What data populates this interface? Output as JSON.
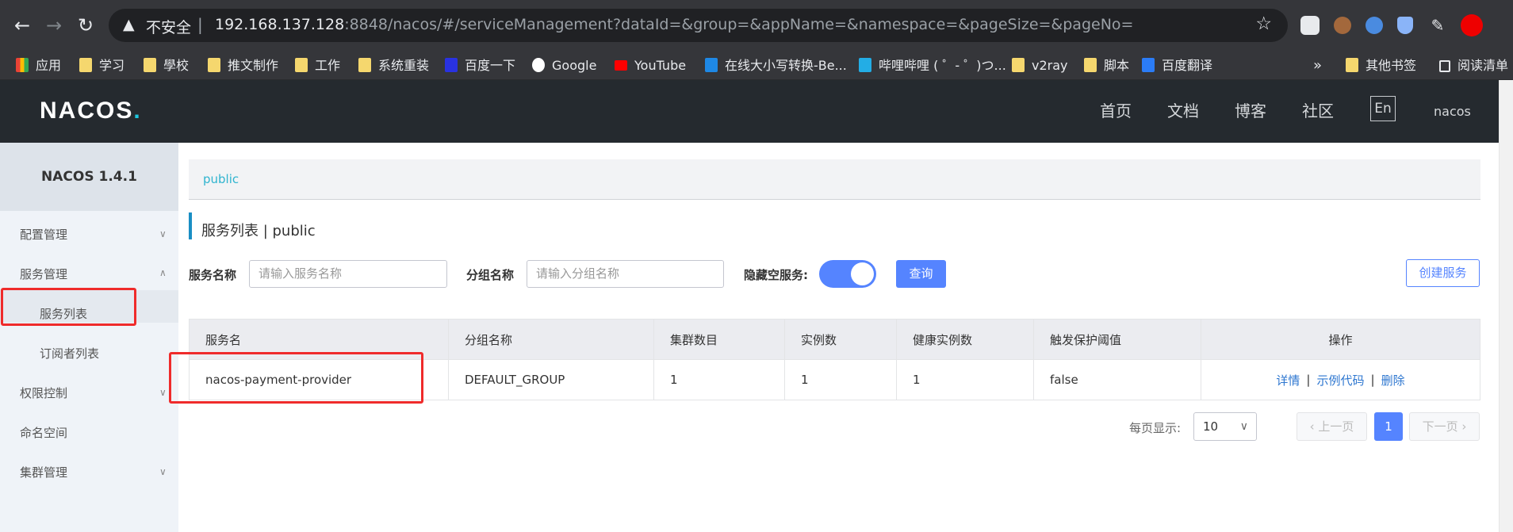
{
  "browser": {
    "insecure_label": "不安全",
    "url_host": "192.168.137.128",
    "url_rest": ":8848/nacos/#/serviceManagement?dataId=&group=&appName=&namespace=&pageSize=&pageNo=",
    "bookmarks": [
      "应用",
      "学习",
      "學校",
      "推文制作",
      "工作",
      "系统重装",
      "百度一下",
      "Google",
      "YouTube",
      "在线大小写转换-Be...",
      "哔哩哔哩 ( ゜- ゜)つ...",
      "v2ray",
      "脚本",
      "百度翻译"
    ],
    "overflow": "»",
    "other_bookmarks": "其他书签",
    "reading_list": "阅读清单"
  },
  "header": {
    "logo": "NACOS",
    "logo_dot": ".",
    "nav": [
      "首页",
      "文档",
      "博客",
      "社区"
    ],
    "lang": "En",
    "user": "nacos"
  },
  "sidebar": {
    "title": "NACOS 1.4.1",
    "items": [
      "配置管理",
      "服务管理",
      "服务列表",
      "订阅者列表",
      "权限控制",
      "命名空间",
      "集群管理"
    ]
  },
  "main": {
    "namespace_tag": "public",
    "page_title": "服务列表  |  public",
    "filters": {
      "service_label": "服务名称",
      "service_placeholder": "请输入服务名称",
      "group_label": "分组名称",
      "group_placeholder": "请输入分组名称",
      "hide_empty_label": "隐藏空服务:",
      "query_button": "查询",
      "create_button": "创建服务"
    },
    "table": {
      "headers": [
        "服务名",
        "分组名称",
        "集群数目",
        "实例数",
        "健康实例数",
        "触发保护阈值",
        "操作"
      ],
      "rows": [
        {
          "name": "nacos-payment-provider",
          "group": "DEFAULT_GROUP",
          "clusters": "1",
          "instances": "1",
          "healthy": "1",
          "threshold": "false"
        }
      ],
      "actions": [
        "详情",
        "示例代码",
        "删除"
      ]
    },
    "pagination": {
      "per_page_label": "每页显示:",
      "per_page": "10",
      "prev": "上一页",
      "current": "1",
      "next": "下一页"
    }
  },
  "colors": {
    "primary": "#5584ff",
    "header_bg": "#252a2f",
    "highlight": "#ef2b2b"
  }
}
